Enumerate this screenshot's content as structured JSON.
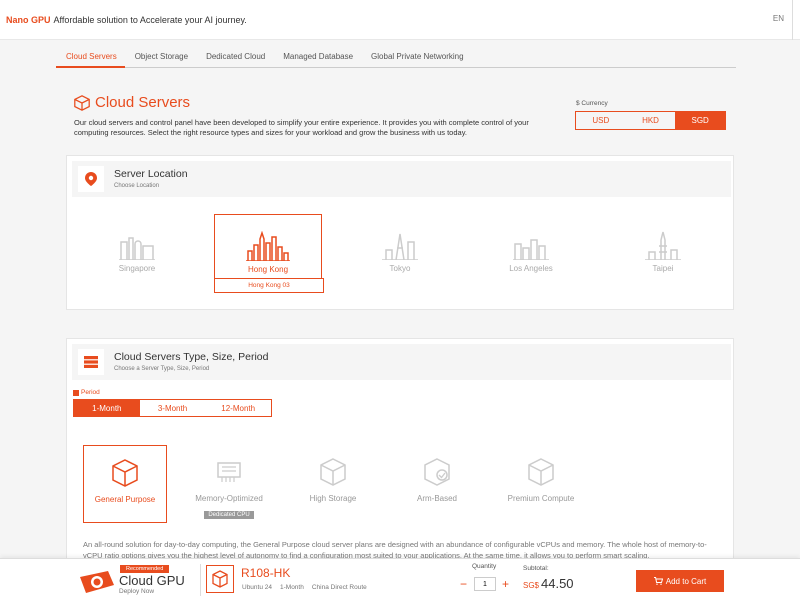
{
  "header": {
    "brand": "Nano GPU",
    "tagline": "Affordable solution to Accelerate your AI journey.",
    "language": "EN"
  },
  "tabs": [
    {
      "label": "Cloud Servers",
      "active": true
    },
    {
      "label": "Object Storage"
    },
    {
      "label": "Dedicated Cloud"
    },
    {
      "label": "Managed Database"
    },
    {
      "label": "Global Private Networking"
    }
  ],
  "hero": {
    "title": "Cloud Servers",
    "description": "Our cloud servers and control panel have been developed to simplify your entire experience. It provides you with complete control of your computing resources. Select the right resource types and sizes for your workload and grow the business with us today."
  },
  "currency": {
    "label": "$ Currency",
    "options": [
      "USD",
      "HKD",
      "SGD"
    ],
    "selected": "SGD"
  },
  "location": {
    "title": "Server Location",
    "subtitle": "Choose Location",
    "options": [
      "Singapore",
      "Hong Kong",
      "Tokyo",
      "Los Angeles",
      "Taipei"
    ],
    "selected": "Hong Kong",
    "selected_zone": "Hong Kong 03"
  },
  "type_section": {
    "title": "Cloud Servers Type, Size, Period",
    "subtitle": "Choose a Server Type, Size, Period",
    "period_label": "Period",
    "periods": [
      "1-Month",
      "3-Month",
      "12-Month"
    ],
    "selected_period": "1-Month",
    "types": [
      "General Purpose",
      "Memory-Optimized",
      "High Storage",
      "Arm-Based",
      "Premium Compute"
    ],
    "memory_badge": "Dedicated CPU",
    "selected_type": "General Purpose",
    "description": "An all-round solution for day-to-day computing, the General Purpose cloud server plans are designed with an abundance of configurable vCPUs and memory. The whole host of memory-to-vCPU ratio options gives you the highest level of autonomy to find a configuration most suited to your applications. At the same time, it allows you to perform smart scaling."
  },
  "footer": {
    "badge": "Recommended",
    "product": "Cloud GPU",
    "deploy": "Deploy Now",
    "plan": "R108-HK",
    "os": "Ubuntu 24",
    "period": "1-Month",
    "route": "China Direct Route",
    "quantity_label": "Quantity",
    "quantity": "1",
    "subtotal_label": "Subtotal:",
    "currency": "SG$",
    "price": "44.50",
    "cart_label": "Add to Cart"
  },
  "colors": {
    "accent": "#e84c1e",
    "muted": "#aaaaaa",
    "background": "#f5f5f5"
  }
}
